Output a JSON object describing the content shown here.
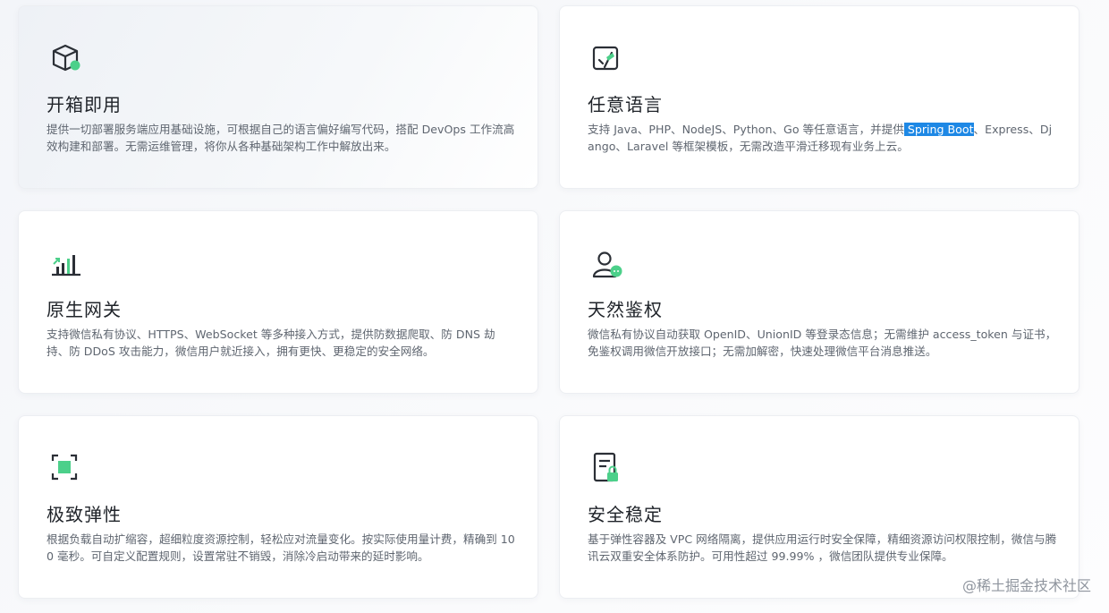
{
  "cards": [
    {
      "title": "开箱即用",
      "desc": "提供一切部署服务端应用基础设施，可根据自己的语言偏好编写代码，搭配 DevOps 工作流高效构建和部署。无需运维管理，将你从各种基础架构工作中解放出来。",
      "icon": "cube-icon"
    },
    {
      "title": "任意语言",
      "desc_before": "支持 Java、PHP、NodeJS、Python、Go 等任意语言，并提供",
      "desc_highlight": " Spring Boot",
      "desc_after": "、Express、Django、Laravel 等框架模板，无需改造平滑迁移现有业务上云。",
      "icon": "code-language-icon"
    },
    {
      "title": "原生网关",
      "desc": "支持微信私有协议、HTTPS、WebSocket 等多种接入方式，提供防数据爬取、防 DNS 劫持、防 DDoS 攻击能力，微信用户就近接入，拥有更快、更稳定的安全网络。",
      "icon": "gateway-chart-icon"
    },
    {
      "title": "天然鉴权",
      "desc": "微信私有协议自动获取 OpenID、UnionID 等登录态信息；无需维护 access_token 与证书，免鉴权调用微信开放接口；无需加解密，快速处理微信平台消息推送。",
      "icon": "user-auth-icon"
    },
    {
      "title": "极致弹性",
      "desc": "根据负载自动扩缩容，超细粒度资源控制，轻松应对流量变化。按实际使用量计费，精确到 100 毫秒。可自定义配置规则，设置常驻不销毁，消除冷启动带来的延时影响。",
      "icon": "elastic-scale-icon"
    },
    {
      "title": "安全稳定",
      "desc": "基于弹性容器及 VPC 网络隔离，提供应用运行时安全保障，精细资源访问权限控制，微信与腾讯云双重安全体系防护。可用性超过 99.99% ，微信团队提供专业保障。",
      "icon": "document-lock-icon"
    }
  ],
  "watermark": "@稀土掘金技术社区",
  "colors": {
    "accent": "#4cd08a",
    "icon_stroke": "#2b2f36",
    "highlight": "#1e88e5"
  }
}
